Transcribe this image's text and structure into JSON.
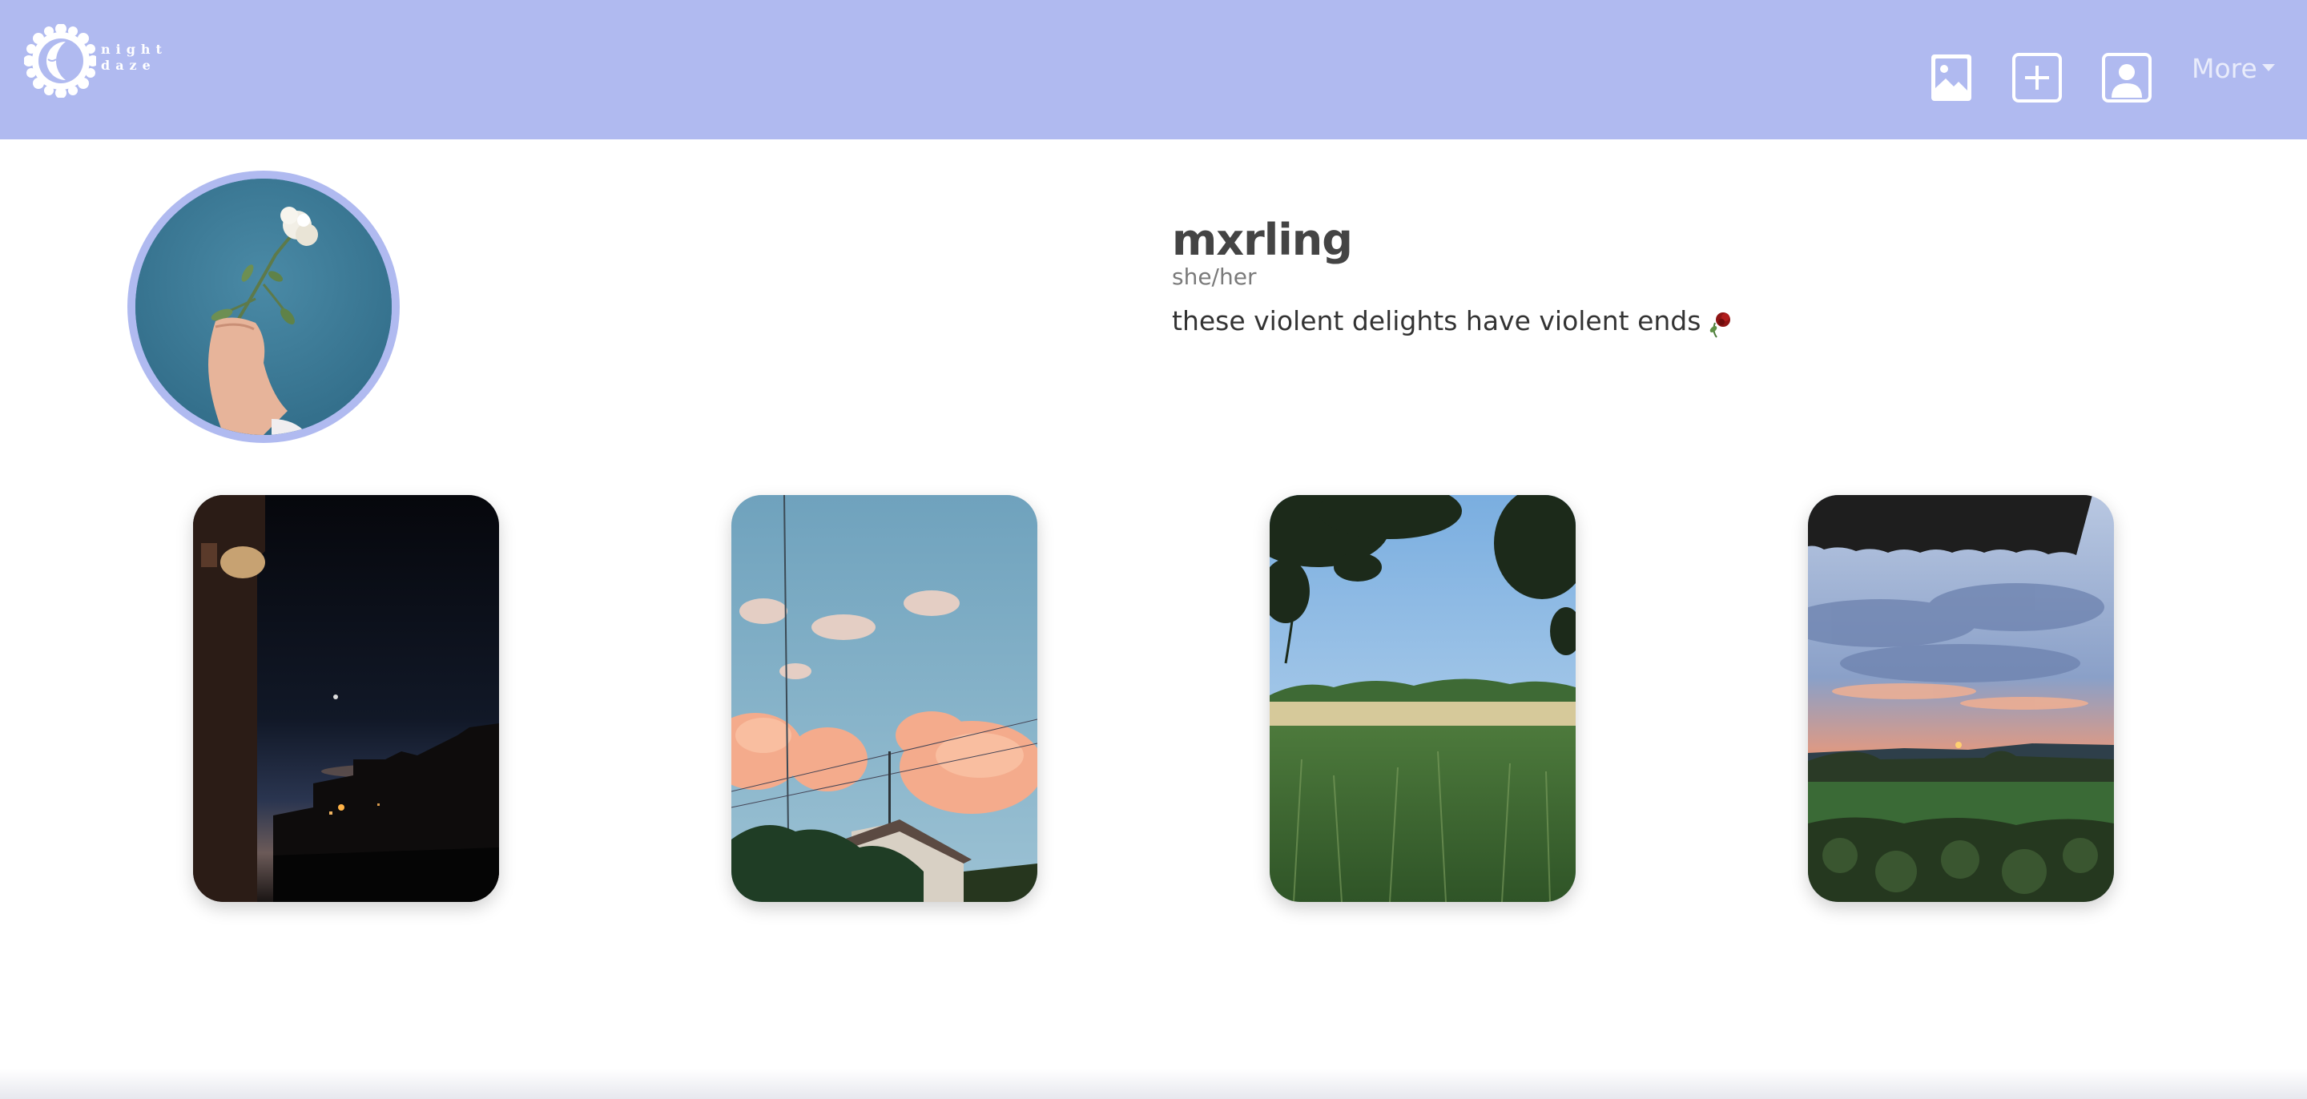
{
  "app": {
    "logo_text": [
      "night",
      "daze"
    ],
    "brand_color": "#b0baf0"
  },
  "nav": {
    "icons": [
      "gallery-icon",
      "add-post-icon",
      "profile-icon"
    ],
    "more_label": "More"
  },
  "profile": {
    "username": "mxrling",
    "pronouns": "she/her",
    "bio": "these violent delights have violent ends",
    "bio_emoji": "rose-emoji",
    "avatar": "hand-holding-white-rose-photo"
  },
  "posts": [
    {
      "image": "night-street-sunset-photo"
    },
    {
      "image": "pink-clouds-sky-photo"
    },
    {
      "image": "green-field-trees-photo"
    },
    {
      "image": "sunset-field-sky-photo"
    }
  ]
}
